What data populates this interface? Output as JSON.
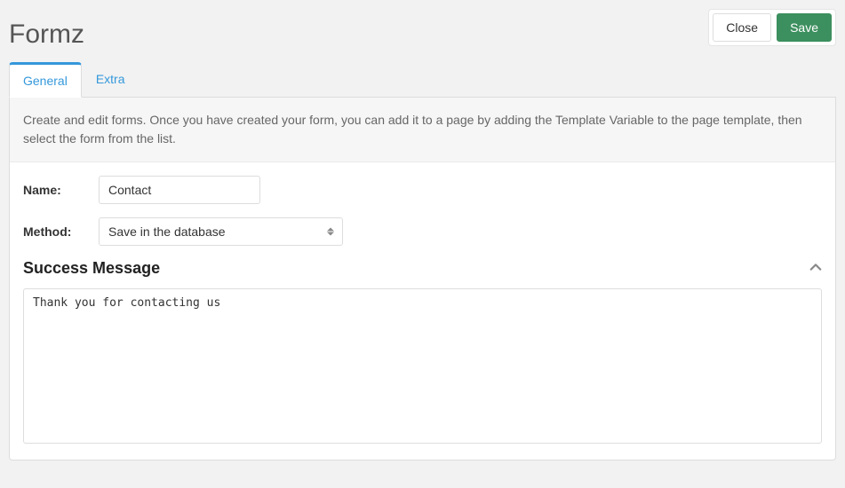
{
  "header": {
    "title": "Formz",
    "close_label": "Close",
    "save_label": "Save"
  },
  "tabs": {
    "general": "General",
    "extra": "Extra"
  },
  "description": "Create and edit forms. Once you have created your form, you can add it to a page by adding the Template Variable to the page template, then select the form from the list.",
  "form": {
    "name_label": "Name:",
    "name_value": "Contact",
    "method_label": "Method:",
    "method_value": "Save in the database"
  },
  "section": {
    "title": "Success Message",
    "message_value": "Thank you for contacting us"
  }
}
